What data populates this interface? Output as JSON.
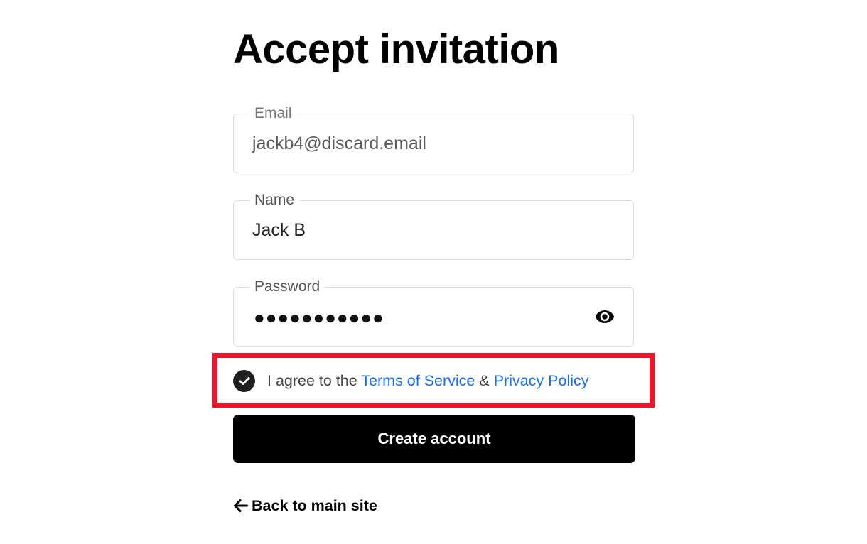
{
  "page": {
    "title": "Accept invitation"
  },
  "form": {
    "email": {
      "label": "Email",
      "value": "jackb4@discard.email"
    },
    "name": {
      "label": "Name",
      "value": "Jack B"
    },
    "password": {
      "label": "Password",
      "masked_value": "●●●●●●●●●●●",
      "toggle_icon": "eye-icon"
    },
    "agreement": {
      "checked": true,
      "prefix": "I agree to the ",
      "terms_link": "Terms of Service",
      "separator": " & ",
      "privacy_link": "Privacy Policy"
    },
    "submit_label": "Create account"
  },
  "footer": {
    "back_label": "Back to main site",
    "back_icon": "arrow-left-icon"
  },
  "colors": {
    "highlight_border": "#e8192c",
    "link": "#1a6ee0",
    "button_bg": "#000000",
    "checkbox_bg": "#1f1f1f"
  }
}
